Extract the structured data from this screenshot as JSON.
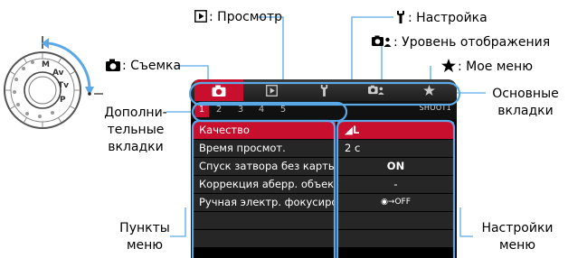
{
  "colors": {
    "accent": "#c8102e",
    "callout": "#5aa9e6",
    "screen_bg": "#000000"
  },
  "callouts": {
    "playback": {
      "icon": "playback-icon",
      "text": ": Просмотр"
    },
    "setup": {
      "icon": "wrench-icon",
      "text": ": Настройка"
    },
    "display_level": {
      "icon": "display-level-icon",
      "text": ": Уровень отображения"
    },
    "shooting": {
      "icon": "camera-icon",
      "text": ": Съемка"
    },
    "my_menu": {
      "icon": "star-icon",
      "text": ": Мое меню"
    },
    "main_tabs": {
      "line1": "Основные",
      "line2": "вкладки"
    },
    "secondary_tabs": {
      "line1": "Дополни-",
      "line2": "тельные",
      "line3": "вкладки"
    },
    "menu_items": {
      "line1": "Пункты",
      "line2": "меню"
    },
    "menu_settings": {
      "line1": "Настройки",
      "line2": "меню"
    }
  },
  "mode_dial": {
    "marks": [
      "M",
      "Av",
      "Tv",
      "P"
    ]
  },
  "screen": {
    "title": "SHOOT1",
    "main_tabs": [
      {
        "icon": "camera-icon",
        "active": true
      },
      {
        "icon": "playback-icon",
        "active": false
      },
      {
        "icon": "wrench-icon",
        "active": false
      },
      {
        "icon": "display-level-icon",
        "active": false
      },
      {
        "icon": "star-icon",
        "active": false
      }
    ],
    "sub_tabs": [
      "1",
      "2",
      "3",
      "4",
      "5"
    ],
    "active_sub_tab": "1",
    "rows": [
      {
        "name": "Качество",
        "value": "◢L",
        "selected": true
      },
      {
        "name": "Время просмот.",
        "value": "2 с",
        "selected": false
      },
      {
        "name": "Спуск затвора без карты",
        "value": "ON",
        "selected": false
      },
      {
        "name": "Коррекция аберр. объектива",
        "value": "-",
        "selected": false
      },
      {
        "name": "Ручная электр. фокусировка",
        "value": "◉→OFF",
        "selected": false
      }
    ]
  }
}
